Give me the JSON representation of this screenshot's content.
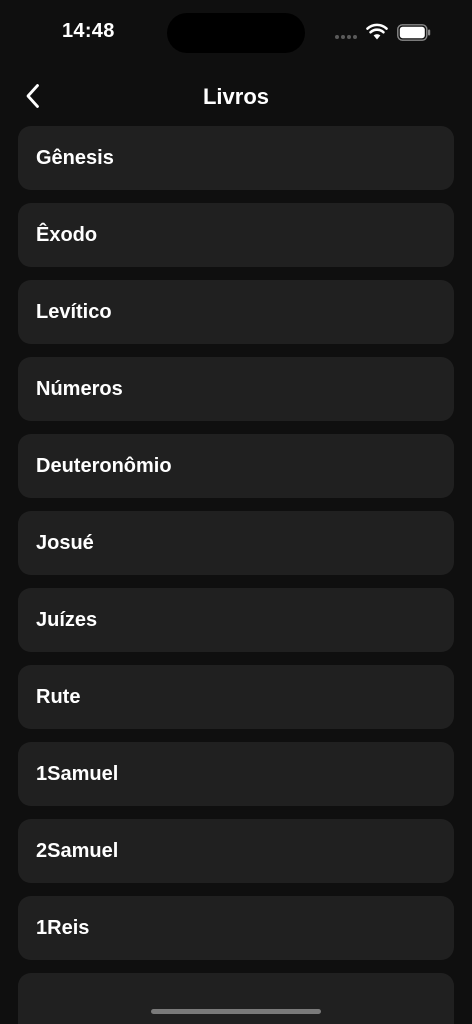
{
  "status_bar": {
    "time": "14:48"
  },
  "nav": {
    "title": "Livros",
    "back_icon": "chevron-left-icon"
  },
  "books": [
    {
      "label": "Gênesis"
    },
    {
      "label": "Êxodo"
    },
    {
      "label": "Levítico"
    },
    {
      "label": "Números"
    },
    {
      "label": "Deuteronômio"
    },
    {
      "label": "Josué"
    },
    {
      "label": "Juízes"
    },
    {
      "label": "Rute"
    },
    {
      "label": "1Samuel"
    },
    {
      "label": "2Samuel"
    },
    {
      "label": "1Reis"
    },
    {
      "label": ""
    }
  ],
  "colors": {
    "background": "#0f0f0f",
    "card": "#202020",
    "text": "#ffffff"
  }
}
